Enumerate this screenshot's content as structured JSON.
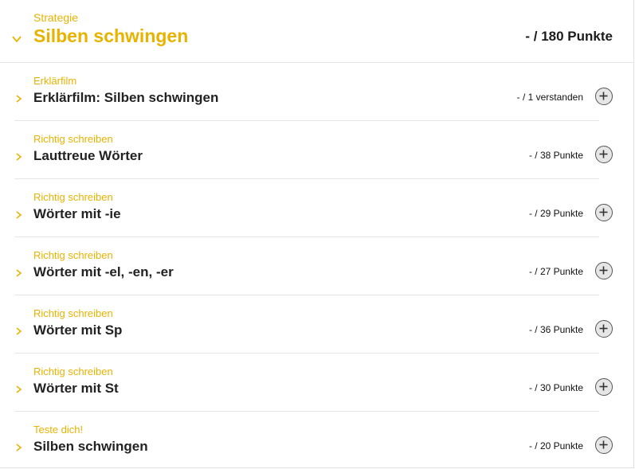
{
  "header": {
    "category": "Strategie",
    "title": "Silben schwingen",
    "points": "- / 180 Punkte"
  },
  "items": [
    {
      "category": "Erklärfilm",
      "title": "Erklärfilm: Silben schwingen",
      "points": "- / 1 verstanden"
    },
    {
      "category": "Richtig schreiben",
      "title": "Lauttreue Wörter",
      "points": "- / 38 Punkte"
    },
    {
      "category": "Richtig schreiben",
      "title": "Wörter mit -ie",
      "points": "- / 29 Punkte"
    },
    {
      "category": "Richtig schreiben",
      "title": "Wörter mit -el, -en, -er",
      "points": "- / 27 Punkte"
    },
    {
      "category": "Richtig schreiben",
      "title": "Wörter mit Sp",
      "points": "- / 36 Punkte"
    },
    {
      "category": "Richtig schreiben",
      "title": "Wörter mit St",
      "points": "- / 30 Punkte"
    },
    {
      "category": "Teste dich!",
      "title": "Silben schwingen",
      "points": "- / 20 Punkte"
    }
  ],
  "colors": {
    "accent": "#e8b300",
    "text": "#1c1c1c",
    "divider": "#e6e6e6"
  },
  "icons": {
    "expand": "chevron-down-icon",
    "item": "chevron-right-icon",
    "add": "plus-circle-icon"
  }
}
